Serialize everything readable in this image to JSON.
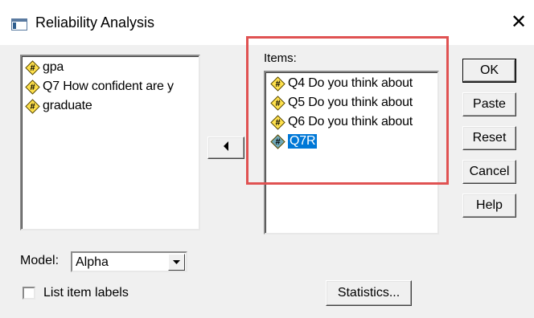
{
  "window": {
    "title": "Reliability Analysis",
    "close_glyph": "✕",
    "title_icon": "spss-dialog-icon"
  },
  "source_list": {
    "items": [
      {
        "label": "gpa",
        "icon": "numeric-variable-icon"
      },
      {
        "label": "Q7 How confident are y",
        "icon": "numeric-variable-icon"
      },
      {
        "label": "graduate",
        "icon": "numeric-variable-icon"
      }
    ]
  },
  "move_button": {
    "icon": "arrow-left-icon"
  },
  "items_panel": {
    "label": "Items:",
    "items": [
      {
        "label": "Q4 Do you think about",
        "icon": "numeric-variable-icon",
        "selected": false
      },
      {
        "label": "Q5 Do you think about",
        "icon": "numeric-variable-icon",
        "selected": false
      },
      {
        "label": "Q6 Do you think about",
        "icon": "numeric-variable-icon",
        "selected": false
      },
      {
        "label": "Q7R",
        "icon": "numeric-variable-icon",
        "selected": true
      }
    ]
  },
  "buttons": {
    "ok": "OK",
    "paste": "Paste",
    "reset": "Reset",
    "cancel": "Cancel",
    "help": "Help",
    "statistics": "Statistics..."
  },
  "model": {
    "label": "Model:",
    "value": "Alpha"
  },
  "list_item_labels": {
    "label": "List item labels",
    "checked": false
  },
  "colors": {
    "highlight_border": "#e05252",
    "selection": "#0078d7",
    "variable_icon_fill": "#ffe14d",
    "selected_icon_fill": "#6fa8b8"
  }
}
